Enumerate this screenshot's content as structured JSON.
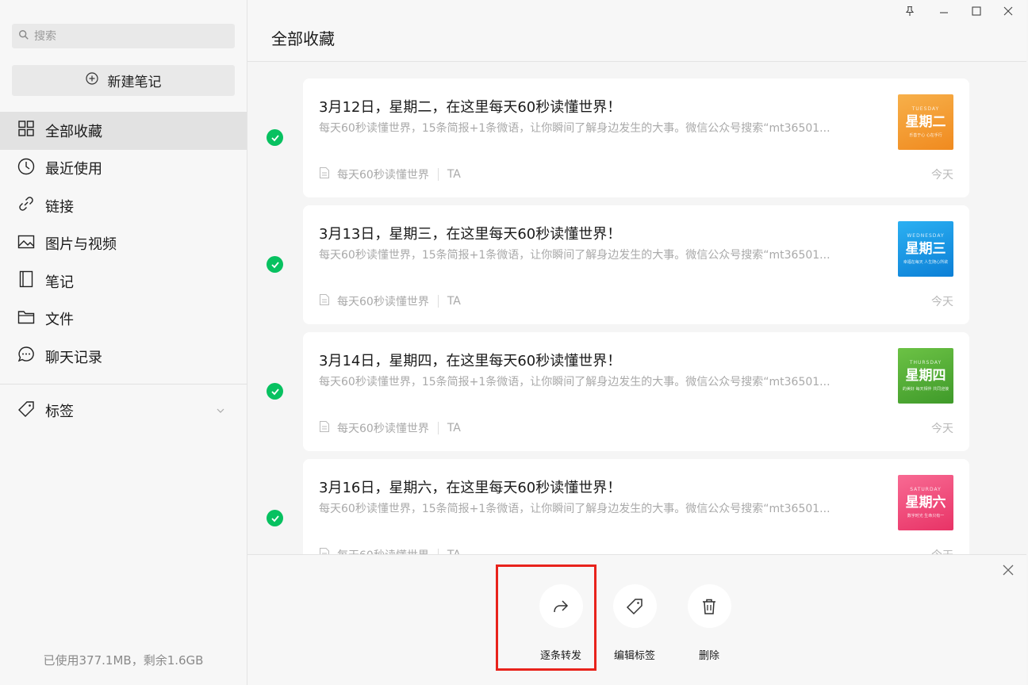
{
  "sidebar": {
    "search_placeholder": "搜索",
    "new_note_label": "新建笔记",
    "nav": [
      {
        "label": "全部收藏",
        "icon": "grid-icon",
        "active": true
      },
      {
        "label": "最近使用",
        "icon": "clock-icon"
      },
      {
        "label": "链接",
        "icon": "link-icon"
      },
      {
        "label": "图片与视频",
        "icon": "image-icon"
      },
      {
        "label": "笔记",
        "icon": "notebook-icon"
      },
      {
        "label": "文件",
        "icon": "folder-icon"
      },
      {
        "label": "聊天记录",
        "icon": "chat-icon"
      }
    ],
    "tags_label": "标签",
    "storage_text": "已使用377.1MB，剩余1.6GB"
  },
  "main": {
    "title": "全部收藏",
    "cards": [
      {
        "title": "3月12日，星期二，在这里每天60秒读懂世界！",
        "desc": "每天60秒读懂世界，15条简报+1条微语，让你瞬间了解身边发生的大事。微信公众号搜索“mt36501...",
        "source": "每天60秒读懂世界",
        "author": "TA",
        "time": "今天",
        "thumb_en": "TUESDAY",
        "thumb_cn": "星期二",
        "thumb_sub": "乐善于心 心在手行",
        "thumb_color": "#f5a035",
        "checked": true
      },
      {
        "title": "3月13日，星期三，在这里每天60秒读懂世界！",
        "desc": "每天60秒读懂世界，15条简报+1条微语，让你瞬间了解身边发生的大事。微信公众号搜索“mt36501...",
        "source": "每天60秒读懂世界",
        "author": "TA",
        "time": "今天",
        "thumb_en": "WEDNESDAY",
        "thumb_cn": "星期三",
        "thumb_sub": "幸福在每天 人生随心所欲",
        "thumb_color": "#1c9be8",
        "checked": true
      },
      {
        "title": "3月14日，星期四，在这里每天60秒读懂世界！",
        "desc": "每天60秒读懂世界，15条简报+1条微语，让你瞬间了解身边发生的大事。微信公众号搜索“mt36501...",
        "source": "每天60秒读懂世界",
        "author": "TA",
        "time": "今天",
        "thumb_en": "THURSDAY",
        "thumb_cn": "星期四",
        "thumb_sub": "的美好 每天相伴 共同迎接",
        "thumb_color": "#5fb53c",
        "checked": true
      },
      {
        "title": "3月16日，星期六，在这里每天60秒读懂世界！",
        "desc": "每天60秒读懂世界，15条简报+1条微语，让你瞬间了解身边发生的大事。微信公众号搜索“mt36501...",
        "source": "每天60秒读懂世界",
        "author": "TA",
        "time": "今天",
        "thumb_en": "SATURDAY",
        "thumb_cn": "星期六",
        "thumb_sub": "数字时光 生命只有一",
        "thumb_color": "#f24f7e",
        "checked": true
      }
    ]
  },
  "actions": [
    {
      "label": "逐条转发",
      "icon": "forward-icon"
    },
    {
      "label": "编辑标签",
      "icon": "tag-icon"
    },
    {
      "label": "删除",
      "icon": "trash-icon"
    }
  ],
  "colors": {
    "check": "#07c160",
    "highlight": "#e8231c"
  }
}
